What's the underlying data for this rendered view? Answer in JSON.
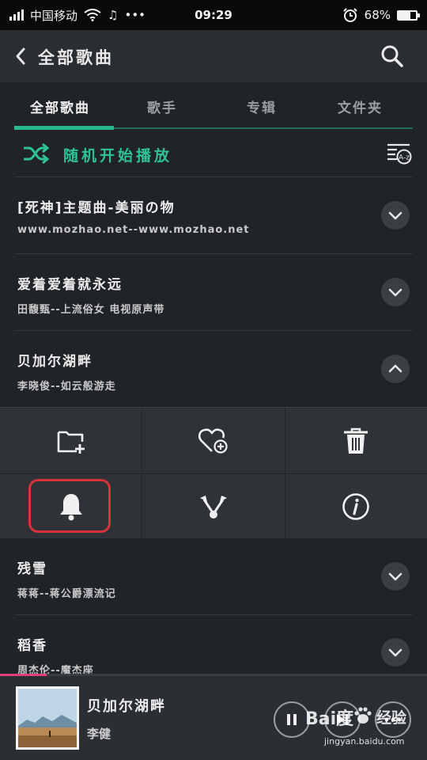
{
  "status_bar": {
    "carrier": "中国移动",
    "time": "09:29",
    "battery": "68%",
    "battery_level": 0.68
  },
  "header": {
    "title": "全部歌曲"
  },
  "tabs": [
    {
      "label": "全部歌曲",
      "active": true
    },
    {
      "label": "歌手",
      "active": false
    },
    {
      "label": "专辑",
      "active": false
    },
    {
      "label": "文件夹",
      "active": false
    }
  ],
  "shuffle": {
    "label": "随机开始播放"
  },
  "songs": [
    {
      "title": "[死神]主题曲-美丽の物",
      "subtitle": "www.mozhao.net--www.mozhao.net",
      "expanded": false
    },
    {
      "title": "爱着爱着就永远",
      "subtitle": "田馥甄--上流俗女 电视原声带",
      "expanded": false
    },
    {
      "title": "贝加尔湖畔",
      "subtitle": "李晓俊--如云般游走",
      "expanded": true
    },
    {
      "title": "残雪",
      "subtitle": "蒋蒋--蒋公爵漂流记",
      "expanded": false
    },
    {
      "title": "稻香",
      "subtitle": "周杰伦--魔杰座",
      "expanded": false
    }
  ],
  "actions": [
    "add-to-playlist-icon",
    "favorite-icon",
    "delete-icon",
    "ringtone-icon",
    "share-icon",
    "info-icon"
  ],
  "player": {
    "title": "贝加尔湖畔",
    "artist": "李健",
    "progress": 0.11
  },
  "watermark": {
    "logo": "Bai度",
    "word": "经验",
    "url": "jingyan.baidu.com"
  },
  "colors": {
    "accent": "#26b98d",
    "highlight": "#d8323c",
    "progress": "#e0407a"
  }
}
